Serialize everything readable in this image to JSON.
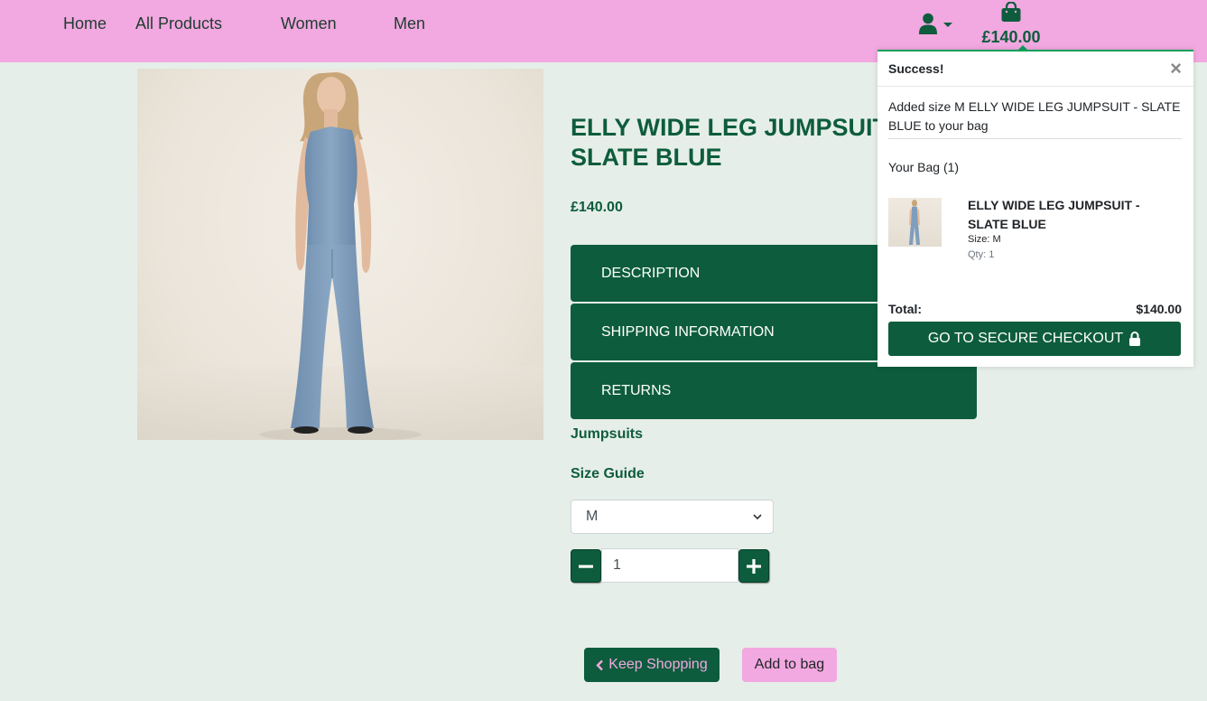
{
  "nav": {
    "home": "Home",
    "all_products": "All Products",
    "women": "Women",
    "men": "Men",
    "bag_total": "£140.00"
  },
  "product": {
    "title": "ELLY WIDE LEG JUMPSUIT - SLATE BLUE",
    "price": "£140.00",
    "accordion": [
      "DESCRIPTION",
      "SHIPPING INFORMATION",
      "RETURNS"
    ],
    "category": "Jumpsuits",
    "size_guide": "Size Guide",
    "size_selected": "M",
    "quantity": "1",
    "keep_shopping": "Keep Shopping",
    "add_to_bag": "Add to bag"
  },
  "toast": {
    "title": "Success!",
    "message": "Added size M ELLY WIDE LEG JUMPSUIT - SLATE BLUE to your bag",
    "bag_count": "Your Bag (1)",
    "item_name": "ELLY WIDE LEG JUMPSUIT - SLATE BLUE",
    "item_size": "Size: M",
    "item_qty": "Qty: 1",
    "total_label": "Total:",
    "total_value": "$140.00",
    "checkout": "GO TO SECURE CHECKOUT"
  },
  "colors": {
    "navbar": "#f2a8e0",
    "brand_green": "#0d5c3d",
    "page_background": "#e6eee9",
    "toast_accent": "#0d9e5a"
  },
  "icons": [
    "user-icon",
    "shopping-bag-icon",
    "close-icon",
    "lock-icon",
    "minus-icon",
    "plus-icon",
    "chevron-left-icon",
    "chevron-down-icon"
  ]
}
